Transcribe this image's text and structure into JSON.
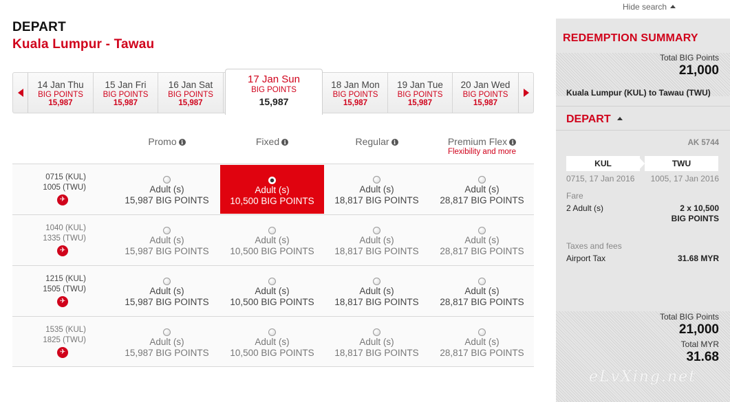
{
  "header": {
    "title": "DEPART",
    "route": "Kuala Lumpur - Tawau"
  },
  "date_strip": {
    "prev_icon": "arrow-left-icon",
    "next_icon": "arrow-right-icon",
    "dates": [
      {
        "label": "14 Jan Thu",
        "unit": "BIG POINTS",
        "points": "15,987"
      },
      {
        "label": "15 Jan Fri",
        "unit": "BIG POINTS",
        "points": "15,987"
      },
      {
        "label": "16 Jan Sat",
        "unit": "BIG POINTS",
        "points": "15,987"
      },
      {
        "label": "17 Jan Sun",
        "unit": "BIG POINTS",
        "points": "15,987",
        "selected": true
      },
      {
        "label": "18 Jan Mon",
        "unit": "BIG POINTS",
        "points": "15,987"
      },
      {
        "label": "19 Jan Tue",
        "unit": "BIG POINTS",
        "points": "15,987"
      },
      {
        "label": "20 Jan Wed",
        "unit": "BIG POINTS",
        "points": "15,987"
      }
    ]
  },
  "fare_types": [
    {
      "label": "Promo",
      "sub": ""
    },
    {
      "label": "Fixed",
      "sub": ""
    },
    {
      "label": "Regular",
      "sub": ""
    },
    {
      "label": "Premium Flex",
      "sub": "Flexibility and more"
    }
  ],
  "flights": [
    {
      "depart": "0715 (KUL)",
      "arrive": "1005 (TWU)",
      "fares": [
        {
          "pax": "Adult (s)",
          "points": "15,987 BIG POINTS"
        },
        {
          "pax": "Adult (s)",
          "points": "10,500 BIG POINTS",
          "selected": true
        },
        {
          "pax": "Adult (s)",
          "points": "18,817 BIG POINTS"
        },
        {
          "pax": "Adult (s)",
          "points": "28,817 BIG POINTS"
        }
      ]
    },
    {
      "depart": "1040 (KUL)",
      "arrive": "1335 (TWU)",
      "fares": [
        {
          "pax": "Adult (s)",
          "points": "15,987 BIG POINTS"
        },
        {
          "pax": "Adult (s)",
          "points": "10,500 BIG POINTS"
        },
        {
          "pax": "Adult (s)",
          "points": "18,817 BIG POINTS"
        },
        {
          "pax": "Adult (s)",
          "points": "28,817 BIG POINTS"
        }
      ]
    },
    {
      "depart": "1215 (KUL)",
      "arrive": "1505 (TWU)",
      "fares": [
        {
          "pax": "Adult (s)",
          "points": "15,987 BIG POINTS"
        },
        {
          "pax": "Adult (s)",
          "points": "10,500 BIG POINTS"
        },
        {
          "pax": "Adult (s)",
          "points": "18,817 BIG POINTS"
        },
        {
          "pax": "Adult (s)",
          "points": "28,817 BIG POINTS"
        }
      ]
    },
    {
      "depart": "1535 (KUL)",
      "arrive": "1825 (TWU)",
      "fares": [
        {
          "pax": "Adult (s)",
          "points": "15,987 BIG POINTS"
        },
        {
          "pax": "Adult (s)",
          "points": "10,500 BIG POINTS"
        },
        {
          "pax": "Adult (s)",
          "points": "18,817 BIG POINTS"
        },
        {
          "pax": "Adult (s)",
          "points": "28,817 BIG POINTS"
        }
      ]
    }
  ],
  "sidebar": {
    "hide_search": "Hide search",
    "title": "REDEMPTION SUMMARY",
    "total_points_label": "Total BIG Points",
    "total_points_value": "21,000",
    "route": "Kuala Lumpur (KUL) to Tawau (TWU)",
    "depart_label": "DEPART",
    "flight_no": "AK 5744",
    "from_code": "KUL",
    "to_code": "TWU",
    "from_time": "0715, 17 Jan 2016",
    "to_time": "1005, 17 Jan 2016",
    "fare_label": "Fare",
    "fare_pax": "2 Adult (s)",
    "fare_value": "2 x 10,500",
    "fare_unit": "BIG POINTS",
    "taxes_label": "Taxes and fees",
    "tax_name": "Airport Tax",
    "tax_value": "31.68 MYR",
    "bottom_points_label": "Total BIG Points",
    "bottom_points_value": "21,000",
    "total_myr_label": "Total MYR",
    "total_myr_value": "31.68"
  },
  "watermark": "eLvXing.net",
  "colors": {
    "accent": "#d0021b",
    "selected_fare": "#e0030f",
    "sidebar_bg": "#e6e6e6"
  }
}
